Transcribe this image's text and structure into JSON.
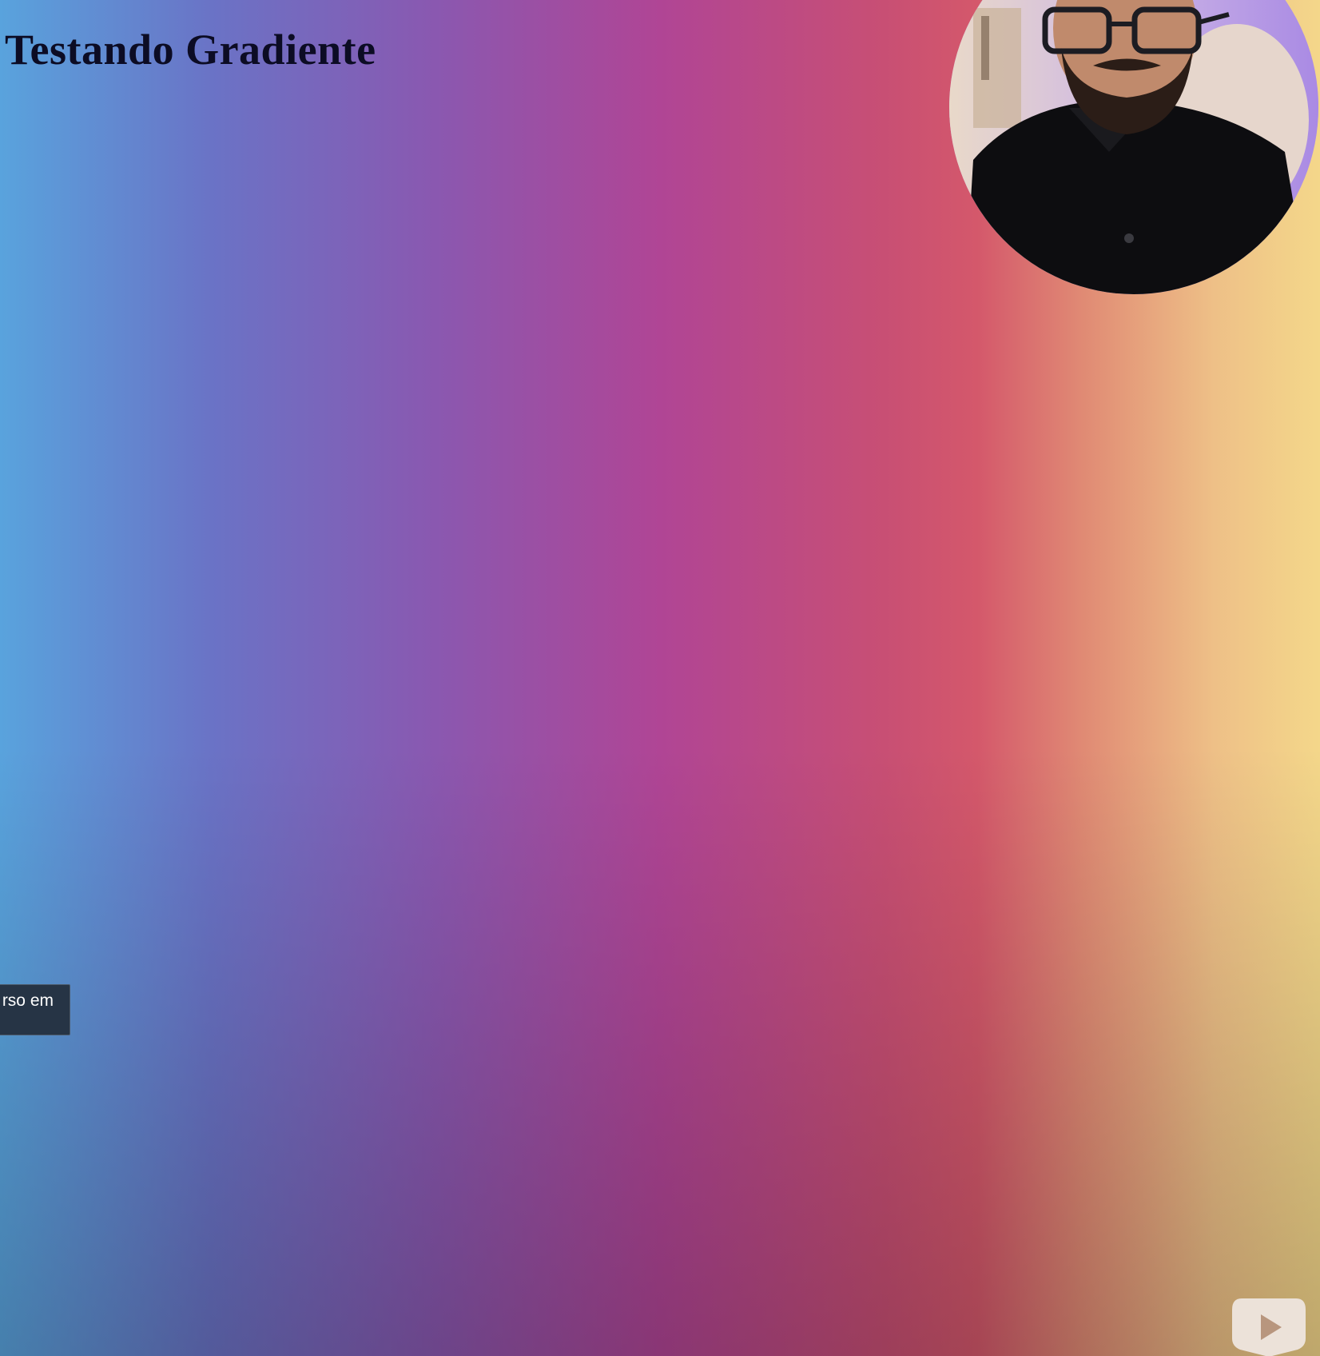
{
  "page": {
    "title": "Testando Gradiente"
  },
  "tooltip": {
    "text": "rso em"
  },
  "background": {
    "gradient_direction": "to right",
    "colors": [
      "#59a3dd",
      "#6a73c6",
      "#8a58b0",
      "#b04595",
      "#c84f74",
      "#d4586b",
      "#e08a74",
      "#eec087",
      "#f4d78a"
    ]
  },
  "icons": {
    "play_button": "play-icon",
    "webcam": "webcam-presenter"
  }
}
